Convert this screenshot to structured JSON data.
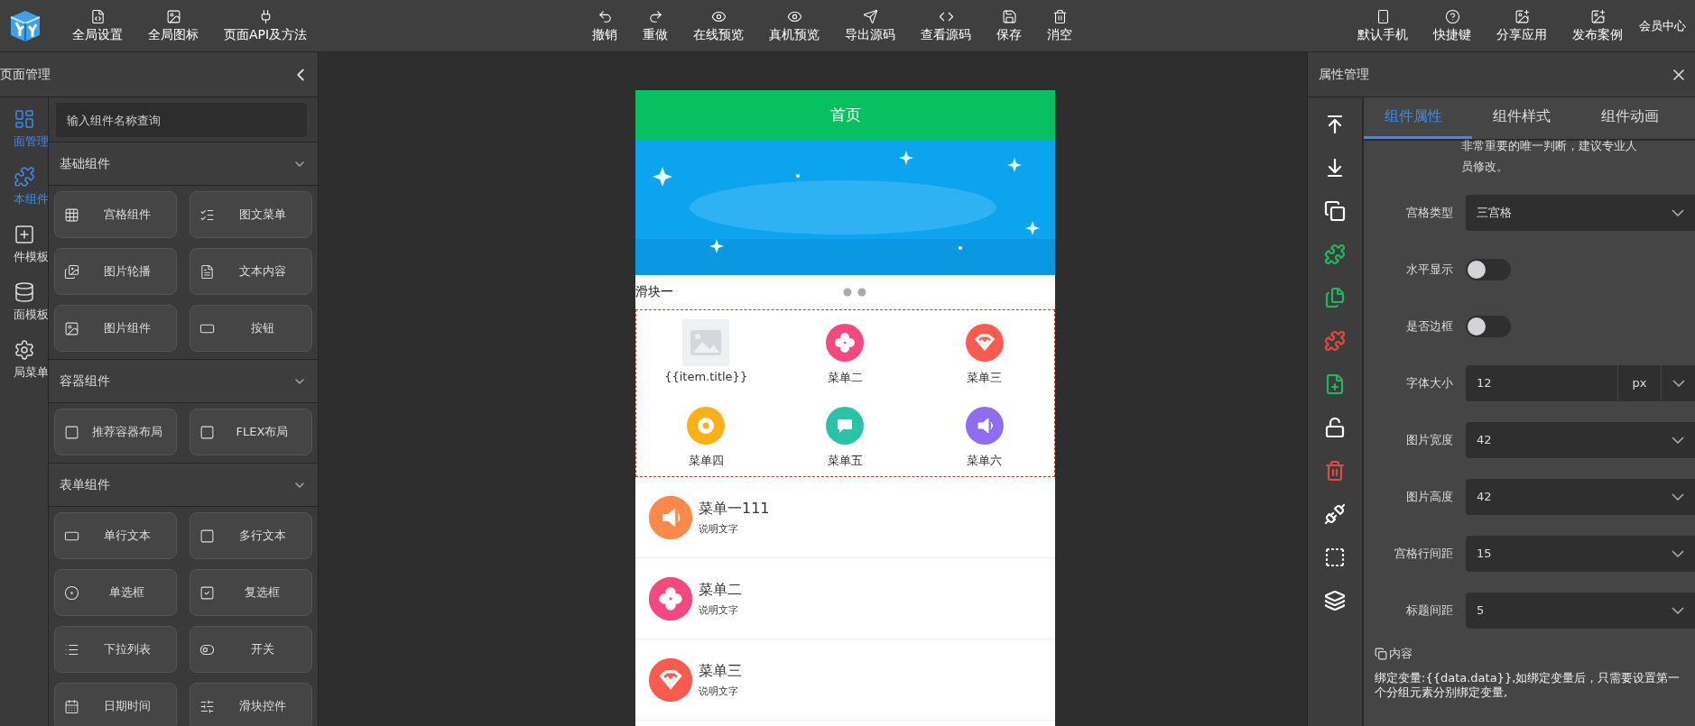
{
  "topbar": {
    "left_tools": [
      {
        "label": "全局设置"
      },
      {
        "label": "全局图标"
      },
      {
        "label": "页面API及方法"
      }
    ],
    "center_tools": [
      {
        "label": "撤销"
      },
      {
        "label": "重做"
      },
      {
        "label": "在线预览"
      },
      {
        "label": "真机预览"
      },
      {
        "label": "导出源码"
      },
      {
        "label": "查看源码"
      },
      {
        "label": "保存"
      },
      {
        "label": "消空"
      }
    ],
    "right_tools": [
      {
        "label": "默认手机"
      },
      {
        "label": "快捷键"
      },
      {
        "label": "分享应用"
      },
      {
        "label": "发布案例"
      }
    ],
    "member": "会员中心"
  },
  "left_panel": {
    "title": "页面管理",
    "nav": [
      {
        "label": "面管理",
        "selected": true
      },
      {
        "label": "本组件",
        "selected": true
      },
      {
        "label": "件模板",
        "selected": false
      },
      {
        "label": "面模板",
        "selected": false
      },
      {
        "label": "局菜单",
        "selected": false
      }
    ],
    "search": {
      "placeholder": "输入组件名称查询"
    },
    "sections": [
      {
        "title": "基础组件",
        "expanded": true,
        "items": [
          {
            "label": "宫格组件"
          },
          {
            "label": "图文菜单"
          },
          {
            "label": "图片轮播"
          },
          {
            "label": "文本内容"
          },
          {
            "label": "图片组件"
          },
          {
            "label": "按钮"
          }
        ]
      },
      {
        "title": "容器组件",
        "expanded": true,
        "items": [
          {
            "label": "推荐容器布局"
          },
          {
            "label": "FLEX布局"
          }
        ]
      },
      {
        "title": "表单组件",
        "expanded": true,
        "items": [
          {
            "label": "单行文本"
          },
          {
            "label": "多行文本"
          },
          {
            "label": "单选框"
          },
          {
            "label": "复选框"
          },
          {
            "label": "下拉列表"
          },
          {
            "label": "开关"
          },
          {
            "label": "日期时间"
          },
          {
            "label": "滑块控件"
          }
        ]
      }
    ]
  },
  "phone": {
    "title": "首页",
    "slider_label": "滑块一",
    "grid": [
      {
        "title": "{{item.title}}",
        "kind": "placeholder"
      },
      {
        "title": "菜单二",
        "kind": "icon",
        "color": "#f5487f"
      },
      {
        "title": "菜单三",
        "kind": "icon",
        "color": "#fb5a4f"
      },
      {
        "title": "菜单四",
        "kind": "icon",
        "color": "#fbb016"
      },
      {
        "title": "菜单五",
        "kind": "icon",
        "color": "#2bc3a8"
      },
      {
        "title": "菜单六",
        "kind": "icon",
        "color": "#8f6cf0"
      }
    ],
    "list": [
      {
        "title": "菜单一111",
        "subtitle": "说明文字",
        "color": "#fb8a4a"
      },
      {
        "title": "菜单二",
        "subtitle": "说明文字",
        "color": "#f5487f"
      },
      {
        "title": "菜单三",
        "subtitle": "说明文字",
        "color": "#fb5a4f"
      }
    ]
  },
  "right_panel": {
    "title": "属性管理",
    "tools": [
      {
        "color": "#ffffff"
      },
      {
        "color": "#ffffff"
      },
      {
        "color": "#ffffff"
      },
      {
        "color": "#1fb85c"
      },
      {
        "color": "#1fb85c"
      },
      {
        "color": "#e04a3f"
      },
      {
        "color": "#1fb85c"
      },
      {
        "color": "#ffffff"
      },
      {
        "color": "#e04a3f"
      },
      {
        "color": "#ffffff"
      },
      {
        "color": "#ffffff"
      },
      {
        "color": "#ffffff"
      }
    ],
    "tabs": [
      {
        "label": "组件属性",
        "selected": true
      },
      {
        "label": "组件样式",
        "selected": false
      },
      {
        "label": "组件动画",
        "selected": false
      }
    ],
    "note": "非常重要的唯一判断，建议专业人员修改。",
    "fields": [
      {
        "kind": "select",
        "label": "宫格类型",
        "value": "三宫格"
      },
      {
        "kind": "switch",
        "label": "水平显示",
        "on": false
      },
      {
        "kind": "switch",
        "label": "是否边框",
        "on": false
      },
      {
        "kind": "unit",
        "label": "字体大小",
        "value": "12",
        "unit": "px"
      },
      {
        "kind": "select",
        "label": "图片宽度",
        "value": "42"
      },
      {
        "kind": "select",
        "label": "图片高度",
        "value": "42"
      },
      {
        "kind": "select",
        "label": "宫格行间距",
        "value": "15"
      },
      {
        "kind": "select",
        "label": "标题间距",
        "value": "5"
      }
    ],
    "content_title": "内容",
    "content_text": "绑定变量:{{data.data}},如绑定变量后，只需要设置第一个分组元素分别绑定变量,"
  }
}
